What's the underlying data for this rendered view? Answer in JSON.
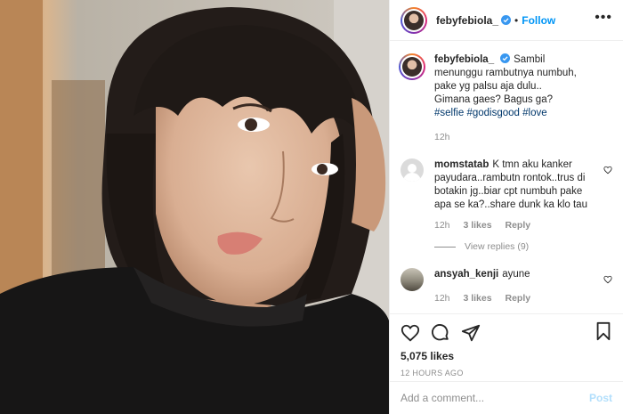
{
  "post": {
    "username": "febyfebiola_",
    "follow_label": "Follow",
    "separator": "•",
    "more_label": "•••"
  },
  "caption": {
    "username": "febyfebiola_",
    "text": "Sambil menunggu rambutnya numbuh, pake yg palsu aja dulu..",
    "line2": "Gimana gaes? Bagus ga?",
    "hashtags": [
      "#selfie",
      "#godisgood",
      "#love"
    ],
    "time": "12h"
  },
  "comments": [
    {
      "username": "momstatab",
      "text": "K tmn aku kanker payudara..rambutn rontok..trus di botakin jg..biar cpt numbuh pake apa se ka?..share dunk ka klo tau",
      "time": "12h",
      "likes": "3 likes",
      "reply": "Reply",
      "view_replies": "View replies (9)"
    },
    {
      "username": "ansyah_kenji",
      "text": "ayune",
      "time": "12h",
      "likes": "3 likes",
      "reply": "Reply"
    }
  ],
  "stats": {
    "likes": "5,075 likes",
    "ago": "12 HOURS AGO"
  },
  "add_comment": {
    "placeholder": "Add a comment...",
    "post_label": "Post"
  },
  "colors": {
    "accent": "#0095f6",
    "hashtag": "#00376b",
    "muted": "#8e8e8e",
    "post_disabled": "#b2dffc"
  },
  "icons": {
    "verified": "verified-badge-icon",
    "like": "heart-icon",
    "comment": "comment-bubble-icon",
    "share": "paper-plane-icon",
    "save": "bookmark-icon"
  }
}
